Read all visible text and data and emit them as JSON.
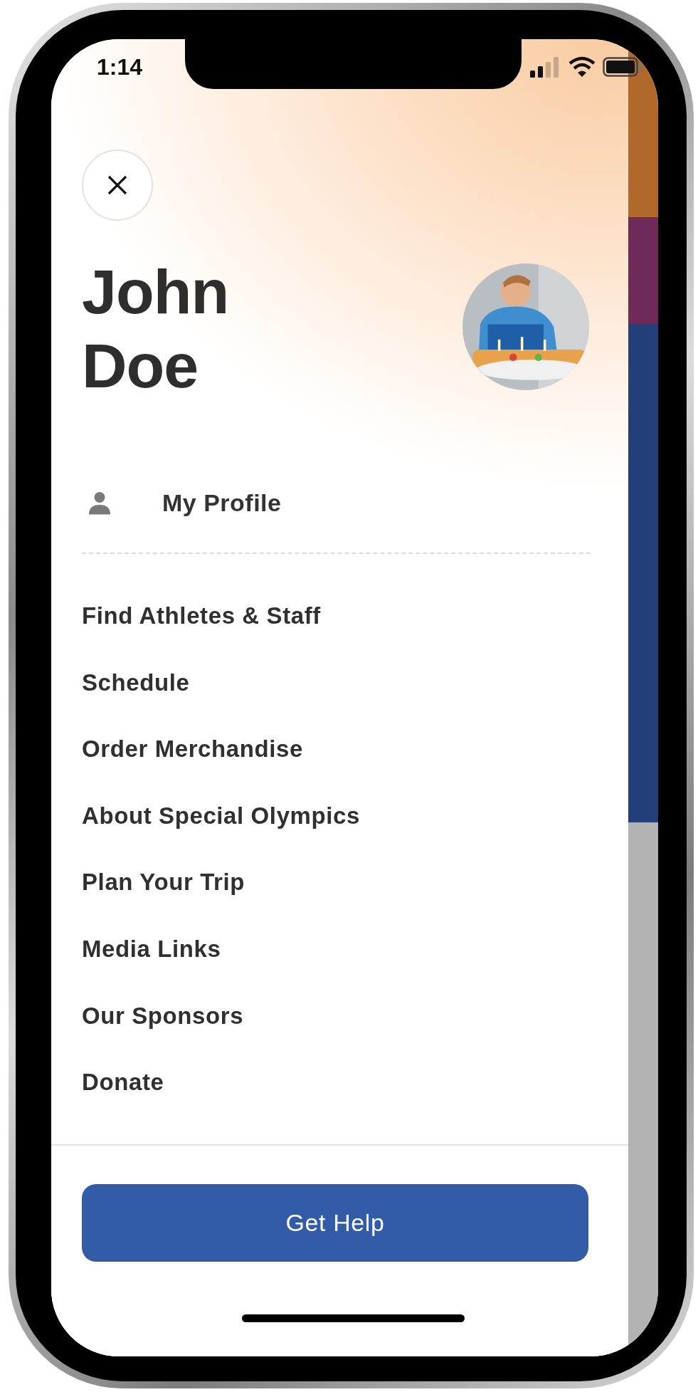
{
  "status_bar": {
    "time": "1:14"
  },
  "user": {
    "name_lines": [
      "John",
      "Doe"
    ]
  },
  "profile_link": {
    "label": "My Profile"
  },
  "menu": [
    {
      "label": "Find Athletes & Staff"
    },
    {
      "label": "Schedule"
    },
    {
      "label": "Order Merchandise"
    },
    {
      "label": "About Special Olympics"
    },
    {
      "label": "Plan Your Trip"
    },
    {
      "label": "Media Links"
    },
    {
      "label": "Our Sponsors"
    },
    {
      "label": "Donate"
    }
  ],
  "help_button": {
    "label": "Get Help"
  }
}
